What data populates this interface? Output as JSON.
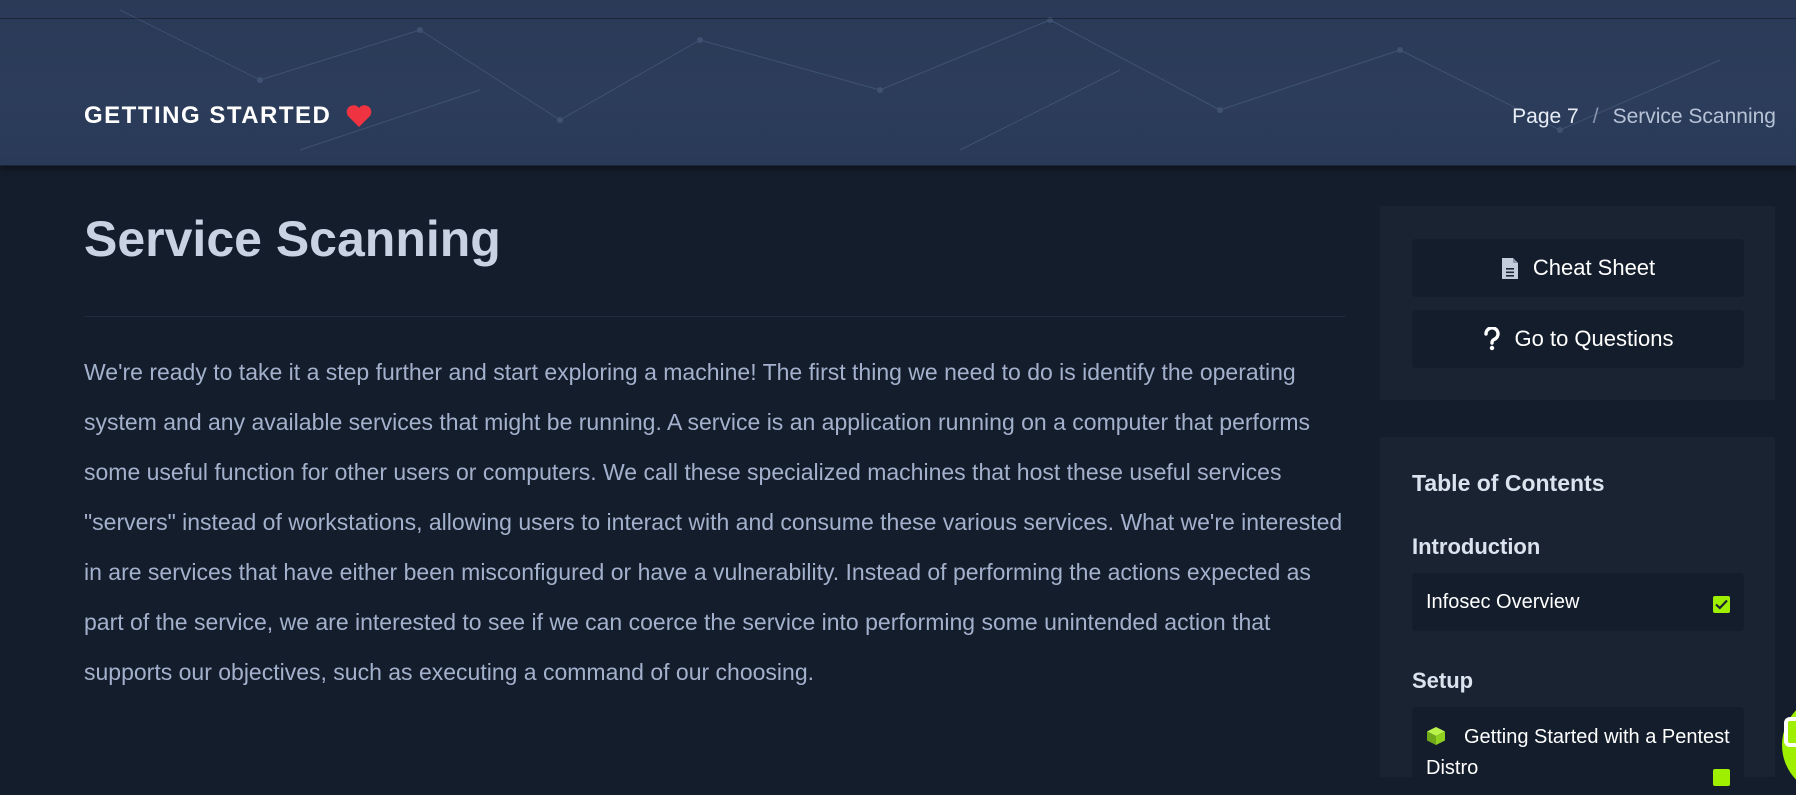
{
  "header": {
    "module_title": "GETTING STARTED",
    "heart_icon": "heart-icon",
    "heart_color": "#ef3340",
    "breadcrumb": {
      "page": "Page 7",
      "separator": "/",
      "current": "Service Scanning"
    }
  },
  "main": {
    "title": "Service Scanning",
    "paragraph": "We're ready to take it a step further and start exploring a machine! The first thing we need to do is identify the operating system and any available services that might be running. A service is an application running on a computer that performs some useful function for other users or computers. We call these specialized machines that host these useful services \"servers\" instead of workstations, allowing users to interact with and consume these various services. What we're interested in are services that have either been misconfigured or have a vulnerability. Instead of performing the actions expected as part of the service, we are interested to see if we can coerce the service into performing some unintended action that supports our objectives, such as executing a command of our choosing."
  },
  "sidebar": {
    "actions": [
      {
        "label": "Cheat Sheet",
        "icon": "document-icon"
      },
      {
        "label": "Go to Questions",
        "icon": "question-icon"
      }
    ],
    "toc": {
      "title": "Table of Contents",
      "sections": [
        {
          "name": "Introduction",
          "items": [
            {
              "label": "Infosec Overview",
              "completed": true
            }
          ]
        },
        {
          "name": "Setup",
          "items": [
            {
              "label": "Getting Started with a Pentest Distro",
              "completed": true,
              "icon": "cube-icon"
            }
          ]
        }
      ]
    }
  },
  "colors": {
    "accent": "#9fef00",
    "background": "#141d2b",
    "header_bg": "#2a3a57",
    "card_bg": "#1a2332"
  }
}
